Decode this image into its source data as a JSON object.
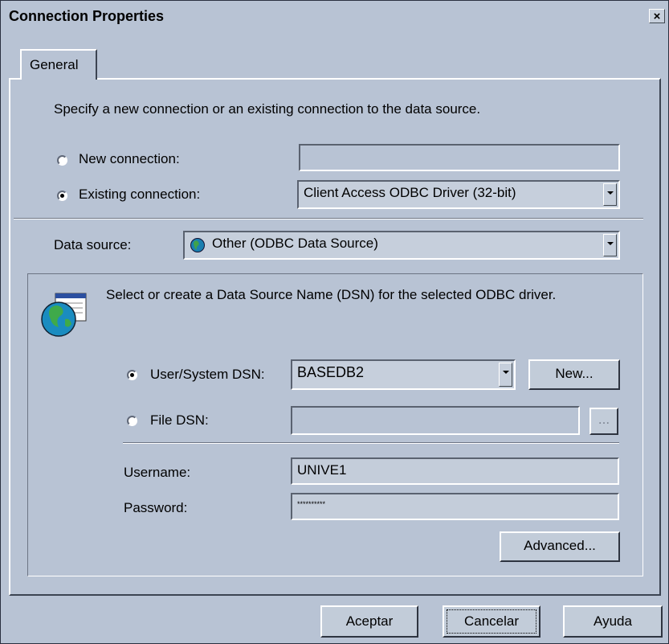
{
  "window": {
    "title": "Connection Properties",
    "close_glyph": "×"
  },
  "tabs": [
    {
      "label": "General",
      "active": true
    }
  ],
  "intro_text": "Specify a new connection or an existing connection to the data source.",
  "connection": {
    "new_label": "New connection:",
    "new_value": "",
    "existing_label": "Existing connection:",
    "existing_value": "Client Access ODBC Driver (32-bit)",
    "selected": "existing"
  },
  "data_source": {
    "label": "Data source:",
    "value": "Other (ODBC Data Source)",
    "icon": "globe-icon"
  },
  "dsn_group": {
    "description": "Select or create a Data Source Name (DSN) for the selected ODBC driver.",
    "icon": "odbc-globe-icon",
    "user_system_label": "User/System DSN:",
    "user_system_value": "BASEDB2",
    "new_button": "New...",
    "file_label": "File DSN:",
    "file_value": "",
    "browse_button": "...",
    "selected": "user_system",
    "username_label": "Username:",
    "username_value": "UNIVE1",
    "password_label": "Password:",
    "password_value": "**********",
    "advanced_button": "Advanced..."
  },
  "footer": {
    "ok": "Aceptar",
    "cancel": "Cancelar",
    "help": "Ayuda"
  },
  "colors": {
    "background": "#b8c3d4",
    "frame": "#3a4150"
  }
}
